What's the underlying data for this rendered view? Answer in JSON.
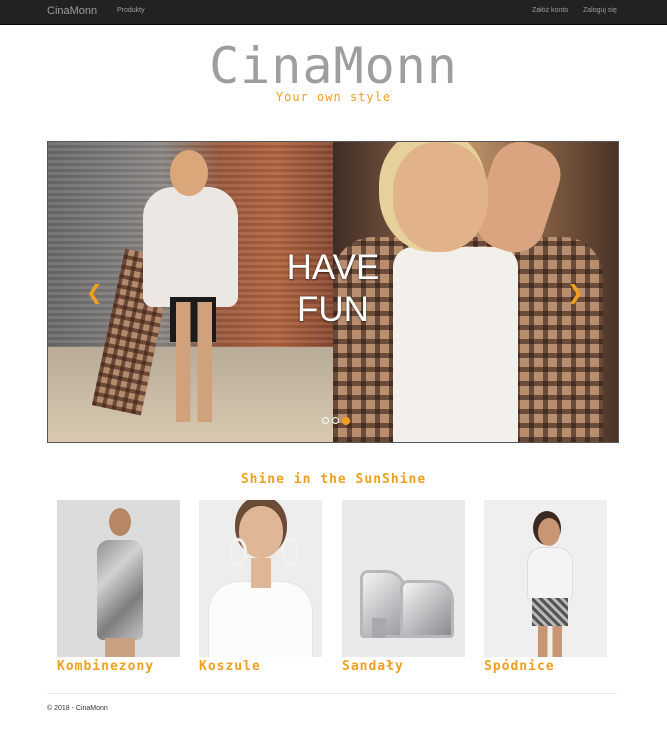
{
  "navbar": {
    "brand": "CinaMonn",
    "products_link": "Produkty",
    "register_link": "Załóż konto",
    "login_link": "Zaloguj się"
  },
  "header": {
    "title": "CinaMonn",
    "tagline": "Your own style"
  },
  "carousel": {
    "caption_line1": "HAVE",
    "caption_line2": "FUN",
    "prev_icon": "chevron-left",
    "next_icon": "chevron-right",
    "slide_count": 3,
    "active_slide": 3
  },
  "products": {
    "section_title": "Shine in the SunShine",
    "items": [
      {
        "label": "Kombinezony"
      },
      {
        "label": "Koszule"
      },
      {
        "label": "Sandały"
      },
      {
        "label": "Spódnice"
      }
    ]
  },
  "footer": {
    "copyright": "© 2018 - CinaMonn"
  },
  "colors": {
    "accent": "#f0a01e",
    "navbar_bg": "#222222",
    "logo_gray": "#9e9e9e"
  }
}
